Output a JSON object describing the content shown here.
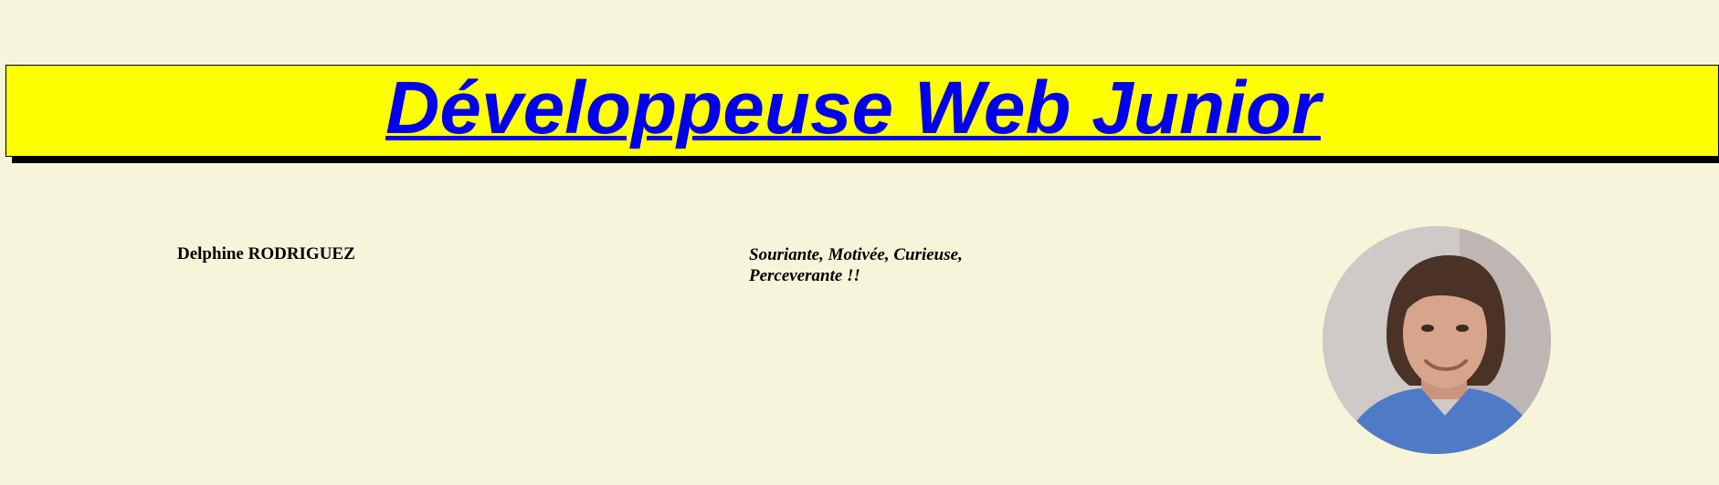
{
  "header": {
    "title": "Développeuse Web Junior"
  },
  "profile": {
    "name": "Delphine RODRIGUEZ",
    "tagline": "Souriante, Motivée, Curieuse, Perceverante !!"
  },
  "colors": {
    "page_background": "#f6f5d9",
    "banner_background": "#ffff00",
    "title_link": "#0000ee",
    "banner_shadow": "#000000",
    "avatar_shirt": "#4f7bc6"
  },
  "icons": {
    "avatar": "profile-photo"
  }
}
